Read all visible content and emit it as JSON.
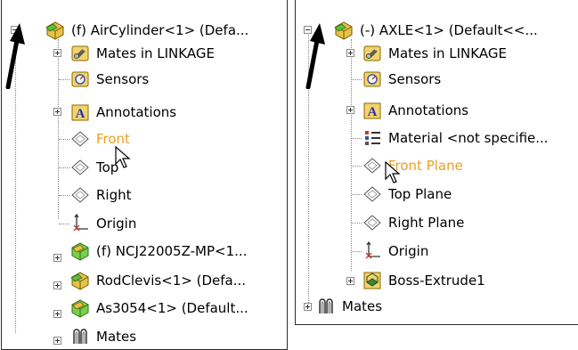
{
  "left_tree": {
    "root_label": "(f) AirCylinder<1> (Defa...",
    "items": [
      {
        "label": "Mates in LINKAGE",
        "icon": "mates-in-assembly-icon"
      },
      {
        "label": "Sensors",
        "icon": "sensors-icon"
      },
      {
        "label": "Annotations",
        "icon": "annotations-icon"
      },
      {
        "label": "Front",
        "icon": "plane-icon",
        "highlight_color": "#e8a023"
      },
      {
        "label": "Top",
        "icon": "plane-icon"
      },
      {
        "label": "Right",
        "icon": "plane-icon"
      },
      {
        "label": "Origin",
        "icon": "origin-icon"
      },
      {
        "label": "(f) NCJ22005Z-MP<1...",
        "icon": "part-icon"
      },
      {
        "label": "RodClevis<1> (Defa...",
        "icon": "part-icon"
      },
      {
        "label": "As3054<1> (Default...",
        "icon": "part-icon"
      },
      {
        "label": "Mates",
        "icon": "mates-icon"
      }
    ]
  },
  "right_tree": {
    "root_label": "(-) AXLE<1> (Default<<...",
    "items": [
      {
        "label": "Mates in LINKAGE",
        "icon": "mates-in-assembly-icon"
      },
      {
        "label": "Sensors",
        "icon": "sensors-icon"
      },
      {
        "label": "Annotations",
        "icon": "annotations-icon"
      },
      {
        "label": "Material <not specifie...",
        "icon": "material-icon"
      },
      {
        "label": "Front Plane",
        "icon": "plane-icon",
        "highlight_color": "#e8a023"
      },
      {
        "label": "Top Plane",
        "icon": "plane-icon"
      },
      {
        "label": "Right Plane",
        "icon": "plane-icon"
      },
      {
        "label": "Origin",
        "icon": "origin-icon"
      },
      {
        "label": "Boss-Extrude1",
        "icon": "extrude-icon"
      }
    ],
    "footer_label": "Mates"
  },
  "colors": {
    "highlight": "#e8a023",
    "border": "#2b2b2b",
    "tree_lines": "#888888"
  }
}
